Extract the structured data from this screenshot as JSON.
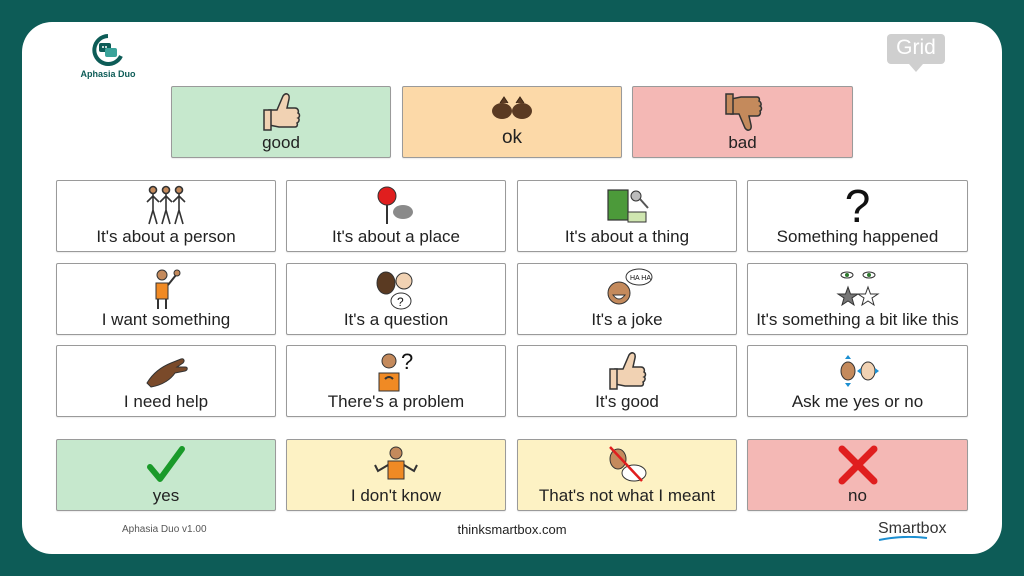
{
  "app": {
    "name": "Aphasia Duo",
    "version": "Aphasia Duo v1.00",
    "website": "thinksmartbox.com",
    "brand": "Smartbox",
    "grid_logo": "Grid"
  },
  "colors": {
    "frame": "#0d5c57",
    "green_cell": "#c6e8cd",
    "orange_cell": "#fcd9a8",
    "red_cell": "#f4b8b5",
    "yellow_cell": "#fdf2c4",
    "smartbox_underline": "#1c8fd1"
  },
  "top_row": [
    {
      "label": "good",
      "icon": "thumbs-up-icon"
    },
    {
      "label": "ok",
      "icon": "ok-hand-icon"
    },
    {
      "label": "bad",
      "icon": "thumbs-down-icon"
    }
  ],
  "grid": [
    {
      "label": "It's about a person",
      "icon": "people-icon"
    },
    {
      "label": "It's about a place",
      "icon": "map-pin-icon"
    },
    {
      "label": "It's about a thing",
      "icon": "objects-icon"
    },
    {
      "label": "Something happened",
      "icon": "question-mark-icon"
    },
    {
      "label": "I want something",
      "icon": "raised-hand-person-icon"
    },
    {
      "label": "It's a question",
      "icon": "question-faces-icon"
    },
    {
      "label": "It's a joke",
      "icon": "laughing-face-icon",
      "bubble_text": "HA HA"
    },
    {
      "label": "It's something a bit like this",
      "icon": "eyes-stars-icon"
    },
    {
      "label": "I need help",
      "icon": "help-hand-icon"
    },
    {
      "label": "There's a problem",
      "icon": "problem-person-icon"
    },
    {
      "label": "It's good",
      "icon": "thumbs-up-icon"
    },
    {
      "label": "Ask me yes or no",
      "icon": "nod-shake-icon"
    }
  ],
  "bottom_row": [
    {
      "label": "yes",
      "icon": "check-icon"
    },
    {
      "label": "I don't know",
      "icon": "shrug-icon"
    },
    {
      "label": "That's not what I meant",
      "icon": "not-meant-icon"
    },
    {
      "label": "no",
      "icon": "cross-icon"
    }
  ]
}
